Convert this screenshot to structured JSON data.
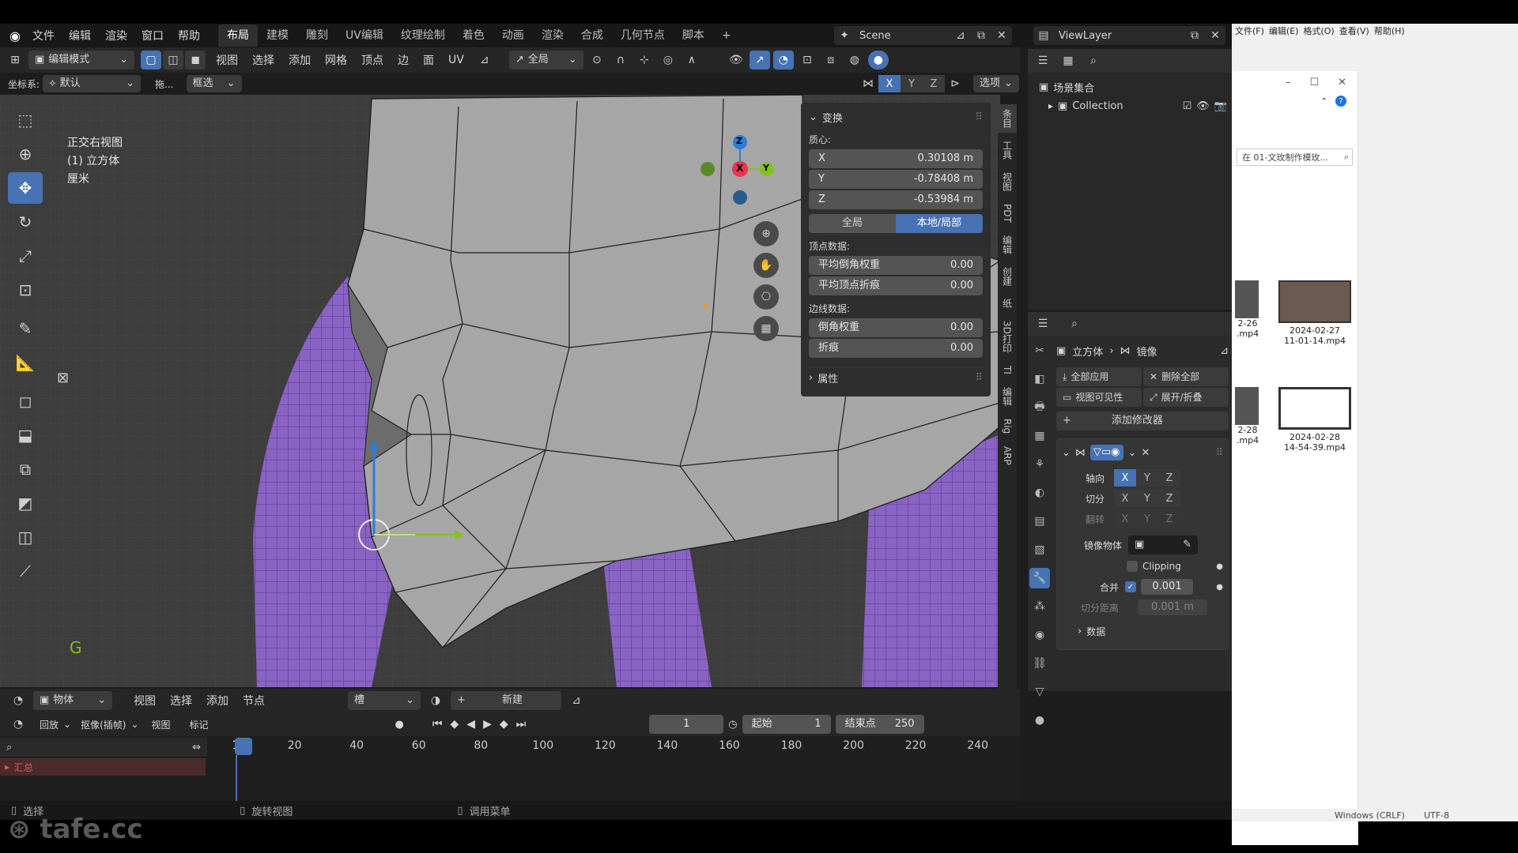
{
  "topbar": {
    "menus": [
      "文件",
      "编辑",
      "渲染",
      "窗口",
      "帮助"
    ],
    "workspaces": [
      "布局",
      "建模",
      "雕刻",
      "UV编辑",
      "纹理绘制",
      "着色",
      "动画",
      "渲染",
      "合成",
      "几何节点",
      "脚本"
    ],
    "active_workspace": "布局",
    "add_tab": "+",
    "scene": "Scene",
    "view_layer": "ViewLayer"
  },
  "viewport_header": {
    "mode": "编辑模式",
    "menus": [
      "视图",
      "选择",
      "添加",
      "网格",
      "顶点",
      "边",
      "面",
      "UV"
    ],
    "transform_orientation": "全局",
    "coord_label": "坐标系:",
    "coord_value": "默认",
    "drag_label": "拖...",
    "select_mode": "框选",
    "mirror_axes": [
      "X",
      "Y",
      "Z"
    ],
    "options": "选项"
  },
  "viewport_overlay": {
    "view_name": "正交右视图",
    "object_name": "(1) 立方体",
    "unit": "厘米",
    "gizmo_axes": [
      "Z",
      "X",
      "Y"
    ],
    "shortcut_key": "G"
  },
  "n_panel": {
    "section_transform": "变换",
    "median_label": "质心:",
    "x_label": "X",
    "x_value": "0.30108 m",
    "y_label": "Y",
    "y_value": "-0.78408 m",
    "z_label": "Z",
    "z_value": "-0.53984 m",
    "global_btn": "全局",
    "local_btn": "本地/局部",
    "vertex_data": "顶点数据:",
    "mean_bevel_weight": "平均倒角权重",
    "mean_bevel_weight_value": "0.00",
    "mean_vertex_crease": "平均顶点折痕",
    "mean_vertex_crease_value": "0.00",
    "edge_data": "边线数据:",
    "bevel_weight": "倒角权重",
    "bevel_weight_value": "0.00",
    "crease": "折痕",
    "crease_value": "0.00",
    "section_properties": "属性",
    "side_tabs": [
      "条目",
      "工具",
      "视图",
      "PDT",
      "编辑",
      "创建",
      "纸",
      "3D打印",
      "TI",
      "编辑",
      "Rig",
      "ARP",
      "",
      ""
    ]
  },
  "outliner": {
    "scene_collection": "场景集合",
    "collection": "Collection"
  },
  "properties": {
    "breadcrumb_object": "立方体",
    "breadcrumb_modifier": "镜像",
    "apply_all": "全部应用",
    "delete_all": "删除全部",
    "viewport_vis": "视图可见性",
    "expand_collapse": "展开/折叠",
    "add_modifier": "添加修改器",
    "axis_label": "轴向",
    "bisect_label": "切分",
    "flip_label": "翻转",
    "axes": [
      "X",
      "Y",
      "Z"
    ],
    "mirror_object_label": "镜像物体",
    "clipping_label": "Clipping",
    "merge_label": "合并",
    "merge_value": "0.001",
    "bisect_distance_label": "切分距离",
    "bisect_distance_value": "0.001 m",
    "data_label": "数据"
  },
  "node_header": {
    "mode": "物体",
    "menus": [
      "视图",
      "选择",
      "添加",
      "节点"
    ],
    "slot": "槽",
    "new_btn": "新建"
  },
  "timeline": {
    "playback": "回放",
    "keying": "抠像(插帧)",
    "view": "视图",
    "marker": "标记",
    "current_frame": "1",
    "start_label": "起始",
    "start_value": "1",
    "end_label": "结束点",
    "end_value": "250",
    "ticks": [
      "1",
      "20",
      "40",
      "60",
      "80",
      "100",
      "120",
      "140",
      "160",
      "180",
      "200",
      "220",
      "240"
    ],
    "summary": "汇总"
  },
  "statusbar": {
    "select": "选择",
    "rotate_view": "旋转视图",
    "call_menu": "调用菜单"
  },
  "explorer": {
    "menus": [
      "文件(F)",
      "编辑(E)",
      "格式(O)",
      "查看(V)",
      "帮助(H)"
    ],
    "search": "在 01-文玫制作模玫...",
    "files": [
      {
        "name": "2024-02-27\n11-01-14.mp4",
        "partial": "2-26\n.mp4"
      },
      {
        "name": "2024-02-28\n14-54-39.mp4",
        "partial": "2-28\n.mp4"
      }
    ],
    "status_encoding": "Windows (CRLF)",
    "status_charset": "UTF-8"
  },
  "watermark": "tafe.cc",
  "colors": {
    "accent": "#4772b3",
    "mesh_face": "#a7a7a7",
    "hair": "#8a63c4",
    "axis_x": "#e8344f",
    "axis_y": "#84c21a",
    "axis_z": "#2f7bd8"
  }
}
